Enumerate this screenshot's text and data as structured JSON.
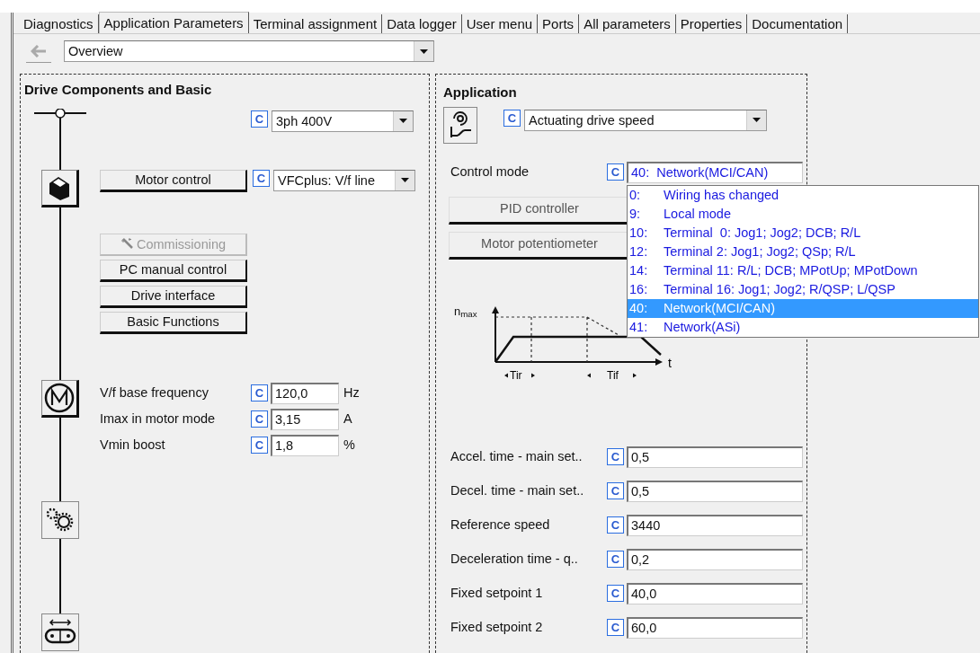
{
  "tabs": [
    {
      "label": "Diagnostics",
      "selected": false
    },
    {
      "label": "Application Parameters",
      "selected": true
    },
    {
      "label": "Terminal assignment",
      "selected": false
    },
    {
      "label": "Data logger",
      "selected": false
    },
    {
      "label": "User menu",
      "selected": false
    },
    {
      "label": "Ports",
      "selected": false
    },
    {
      "label": "All parameters",
      "selected": false
    },
    {
      "label": "Properties",
      "selected": false
    },
    {
      "label": "Documentation",
      "selected": false
    }
  ],
  "view_select": {
    "value": "Overview"
  },
  "drive_panel": {
    "title": "Drive Components and Basic",
    "supply": {
      "flag": "C",
      "value": "3ph 400V"
    },
    "motor_control": {
      "button": "Motor control",
      "flag": "C",
      "value": "VFCplus: V/f line"
    },
    "buttons": [
      {
        "label": "Commissioning",
        "disabled": true
      },
      {
        "label": "PC manual control",
        "disabled": false
      },
      {
        "label": "Drive interface",
        "disabled": false
      },
      {
        "label": "Basic Functions",
        "disabled": false
      }
    ],
    "motor_params": [
      {
        "label": "V/f base frequency",
        "flag": "C",
        "value": "120,0",
        "unit": "Hz"
      },
      {
        "label": "Imax in motor mode",
        "flag": "C",
        "value": "3,15",
        "unit": "A"
      },
      {
        "label": "Vmin boost",
        "flag": "C",
        "value": "1,8",
        "unit": "%"
      }
    ]
  },
  "application_panel": {
    "title": "Application",
    "mode": {
      "flag": "C",
      "value": "Actuating drive speed"
    },
    "control_mode": {
      "label": "Control mode",
      "flag": "C",
      "value": "40:  Network(MCI/CAN)",
      "open": true,
      "options": [
        {
          "code": "0:",
          "label": "Wiring has changed",
          "selected": false
        },
        {
          "code": "9:",
          "label": "Local mode",
          "selected": false
        },
        {
          "code": "10:",
          "label": "Terminal  0: Jog1; Jog2; DCB; R/L",
          "selected": false
        },
        {
          "code": "12:",
          "label": "Terminal 2: Jog1; Jog2; QSp; R/L",
          "selected": false
        },
        {
          "code": "14:",
          "label": "Terminal 11: R/L; DCB; MPotUp; MPotDown",
          "selected": false
        },
        {
          "code": "16:",
          "label": "Terminal 16: Jog1; Jog2; R/QSP; L/QSP",
          "selected": false
        },
        {
          "code": "40:",
          "label": "Network(MCI/CAN)",
          "selected": true
        },
        {
          "code": "41:",
          "label": "Network(ASi)",
          "selected": false
        }
      ]
    },
    "buttons": [
      {
        "label": "PID controller"
      },
      {
        "label": "Motor potentiometer"
      }
    ],
    "ramp_diagram": {
      "y_label": "n$_{max}$",
      "x_label": "t",
      "rise_label": "Tir",
      "fall_label": "Tif"
    },
    "params": [
      {
        "label": "Accel. time - main set..",
        "flag": "C",
        "value": "0,5"
      },
      {
        "label": "Decel. time - main set..",
        "flag": "C",
        "value": "0,5"
      },
      {
        "label": "Reference speed",
        "flag": "C",
        "value": "3440"
      },
      {
        "label": "Deceleration time - q..",
        "flag": "C",
        "value": "0,2"
      },
      {
        "label": "Fixed setpoint 1",
        "flag": "C",
        "value": "40,0"
      },
      {
        "label": "Fixed setpoint 2",
        "flag": "C",
        "value": "60,0"
      }
    ]
  }
}
